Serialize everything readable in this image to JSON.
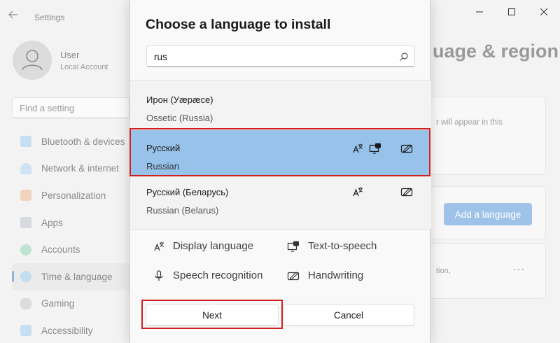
{
  "window": {
    "title": "Settings"
  },
  "user": {
    "name": "User",
    "account_type": "Local Account"
  },
  "sidebar": {
    "search_placeholder": "Find a setting",
    "items": [
      {
        "label": "Bluetooth & devices",
        "icon": "bluetooth-icon",
        "color": "#6aa8e0"
      },
      {
        "label": "Network & internet",
        "icon": "wifi-icon",
        "color": "#7fb8e8"
      },
      {
        "label": "Personalization",
        "icon": "brush-icon",
        "color": "#e6a878"
      },
      {
        "label": "Apps",
        "icon": "apps-icon",
        "color": "#9aa4b0"
      },
      {
        "label": "Accounts",
        "icon": "person-icon",
        "color": "#6cc3a0"
      },
      {
        "label": "Time & language",
        "icon": "globe-clock-icon",
        "color": "#5fa8dc"
      },
      {
        "label": "Gaming",
        "icon": "gamepad-icon",
        "color": "#a8a8a8"
      },
      {
        "label": "Accessibility",
        "icon": "accessibility-icon",
        "color": "#6ab0e0"
      }
    ],
    "active_index": 5
  },
  "main": {
    "title_fragment": "uage & region",
    "card1_text": "r will appear in this",
    "add_language_label": "Add a language",
    "card3_text": "tion,",
    "more_label": "···"
  },
  "dialog": {
    "title": "Choose a language to install",
    "search": {
      "value": "rus",
      "icon": "search-icon"
    },
    "languages": [
      {
        "native": "Ирон (Уæрæсе)",
        "english": "Ossetic (Russia)",
        "features": []
      },
      {
        "native": "Русский",
        "english": "Russian",
        "features": [
          "display-language-icon",
          "text-to-speech-icon",
          "handwriting-icon"
        ],
        "selected": true
      },
      {
        "native": "Русский (Беларусь)",
        "english": "Russian (Belarus)",
        "features": [
          "display-language-icon",
          "handwriting-icon"
        ]
      }
    ],
    "legend": {
      "display_language": "Display language",
      "text_to_speech": "Text-to-speech",
      "speech_recognition": "Speech recognition",
      "handwriting": "Handwriting"
    },
    "next_label": "Next",
    "cancel_label": "Cancel"
  },
  "colors": {
    "selected_row": "#97c2ea",
    "highlight_border": "#d22020",
    "accent_button": "#9fc3e8"
  }
}
